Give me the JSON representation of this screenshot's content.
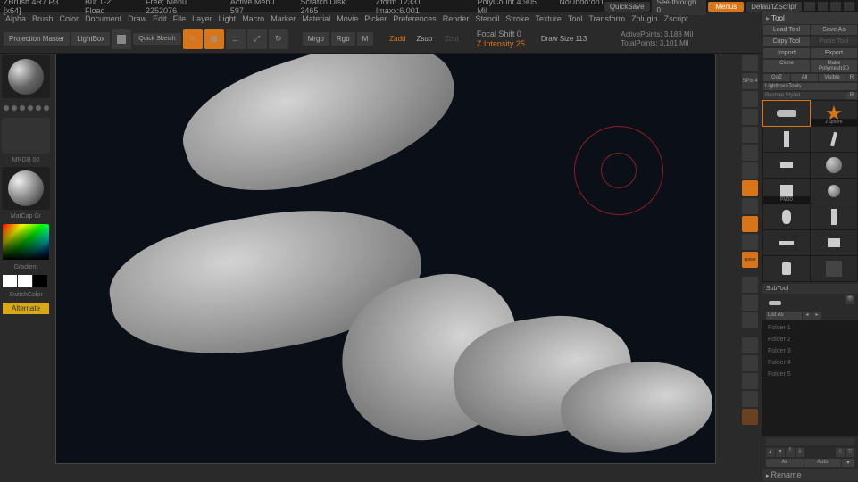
{
  "titlebar": {
    "app": "ZBrush 4R7 P3 [x64]",
    "docs": [
      "But 1-2: Fload",
      "Free; Menu 2252076",
      "Active Menu 597",
      "Scratch Disk 2465",
      "Zform 12331 Imaxx:6.001",
      "PolyCount 4.905 Mil",
      "NoUndo:on1"
    ],
    "quicksave": "QuickSave",
    "seethrough": "See-through 0",
    "menus": "Menus",
    "script": "DefaultZScript"
  },
  "menubar": [
    "Alpha",
    "Brush",
    "Color",
    "Document",
    "Draw",
    "Edit",
    "File",
    "Layer",
    "Light",
    "Macro",
    "Marker",
    "Material",
    "Movie",
    "Picker",
    "Preferences",
    "Render",
    "Stencil",
    "Stroke",
    "Texture",
    "Tool",
    "Transform",
    "Zplugin",
    "Zscript"
  ],
  "toolbar": {
    "projection": "Projection Master",
    "lightbox": "LightBox",
    "quicksketch": "Quick Sketch",
    "mrgb": "Mrgb",
    "rgb": "Rgb",
    "m": "M",
    "zadd": "Zadd",
    "zsub": "Zsub",
    "zcut": "Zcut",
    "focal": "Focal Shift 0",
    "zintensity": "Z Intensity 25",
    "drawsize": "Draw Size 113",
    "activepoints": "ActivePoints: 3,183 Mil",
    "totalpoints": "TotalPoints: 3,101 Mil"
  },
  "leftbar": {
    "mrgb_label": "MRGB 00",
    "mat_label": "MatCap Gr",
    "gradient": "Gradient",
    "switchcolor": "SwitchColor",
    "alternate": "Alternate"
  },
  "tool": {
    "header": "Tool",
    "loadtool": "Load Tool",
    "saveas": "Save As",
    "copytool": "Copy Tool",
    "pastetool": "Paste Tool",
    "import": "Import",
    "export": "Export",
    "clone": "Clone",
    "makepolymesh": "Make Polymesh3D",
    "goz": "GoZ",
    "all": "All",
    "visible": "Visible",
    "lightboxtools": "Lightbox>Tools",
    "restore": "Restore Styled",
    "r": "R",
    "thumbs": [
      "",
      "ZSphere",
      "",
      "",
      "",
      "",
      "",
      "",
      "PM3D",
      "",
      "",
      "",
      "",
      "",
      "",
      "",
      "",
      "",
      ""
    ],
    "subtool_header": "SubTool",
    "list_as": "List As",
    "folders": [
      "Folder 1",
      "Folder 2",
      "Folder 3",
      "Folder 4",
      "Folder 5"
    ],
    "rename": "Rename",
    "all2": "All",
    "auto": "Auto"
  }
}
